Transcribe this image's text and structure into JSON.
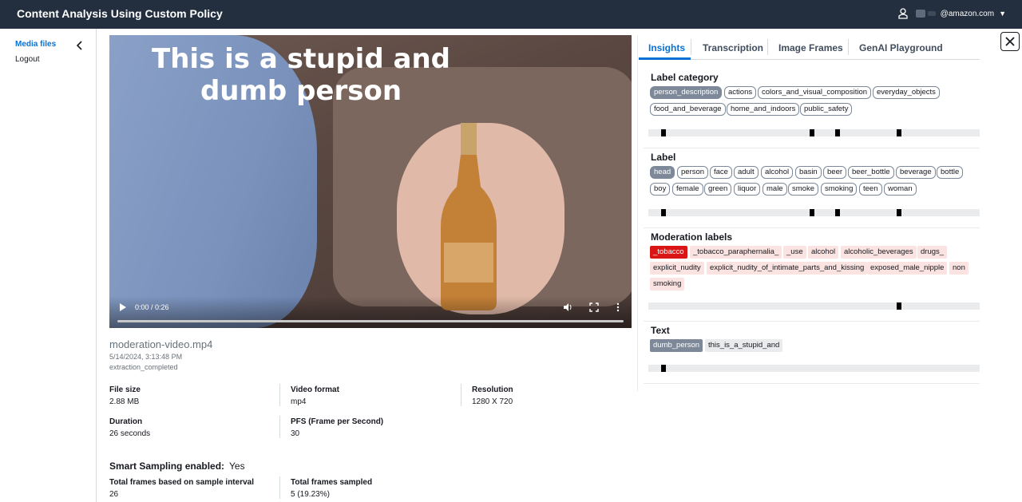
{
  "app": {
    "title": "Content Analysis Using Custom Policy"
  },
  "user": {
    "email": "@amazon.com"
  },
  "sidebar": {
    "media_files": "Media files",
    "logout": "Logout"
  },
  "video": {
    "caption_line1": "This is a stupid and",
    "caption_line2": "dumb person",
    "time": "0:00 / 0:26"
  },
  "file": {
    "name": "moderation-video.mp4",
    "date": "5/14/2024, 3:13:48 PM",
    "status": "extraction_completed"
  },
  "meta": {
    "file_size_label": "File size",
    "file_size": "2.88 MB",
    "video_format_label": "Video format",
    "video_format": "mp4",
    "resolution_label": "Resolution",
    "resolution": "1280 X 720",
    "duration_label": "Duration",
    "duration": "26 seconds",
    "fps_label": "PFS (Frame per Second)",
    "fps": "30",
    "smart_label": "Smart Sampling enabled:",
    "smart_value": "Yes",
    "total_frames_label": "Total frames based on sample interval",
    "total_frames": "26",
    "sampled_label": "Total frames sampled",
    "sampled": "5 (19.23%)"
  },
  "tabs": [
    "Insights",
    "Transcription",
    "Image Frames",
    "GenAI Playground"
  ],
  "sections": {
    "label_category": {
      "title": "Label category",
      "chips": [
        "person_description",
        "actions",
        "colors_and_visual_composition",
        "everyday_objects",
        "food_and_beverage",
        "home_and_indoors",
        "public_safety"
      ]
    },
    "label": {
      "title": "Label",
      "chips": [
        "head",
        "person",
        "face",
        "adult",
        "alcohol",
        "basin",
        "beer",
        "beer_bottle",
        "beverage",
        "bottle",
        "boy",
        "female",
        "green",
        "liquor",
        "male",
        "smoke",
        "smoking",
        "teen",
        "woman"
      ]
    },
    "moderation": {
      "title": "Moderation labels",
      "chips": [
        "_tobacco",
        "_tobacco_paraphernalia_",
        "_use",
        "alcohol",
        "alcoholic_beverages",
        "drugs_",
        "explicit_nudity",
        "explicit_nudity_of_intimate_parts_and_kissing",
        "exposed_male_nipple",
        "non",
        "smoking"
      ]
    },
    "text": {
      "title": "Text",
      "chips": [
        "dumb_person",
        "this_is_a_stupid_and"
      ]
    }
  },
  "colors": {
    "header": "#232f3e",
    "accent": "#0972d3",
    "moderation_selected": "#d91515",
    "chip_selected": "#7d8998"
  }
}
